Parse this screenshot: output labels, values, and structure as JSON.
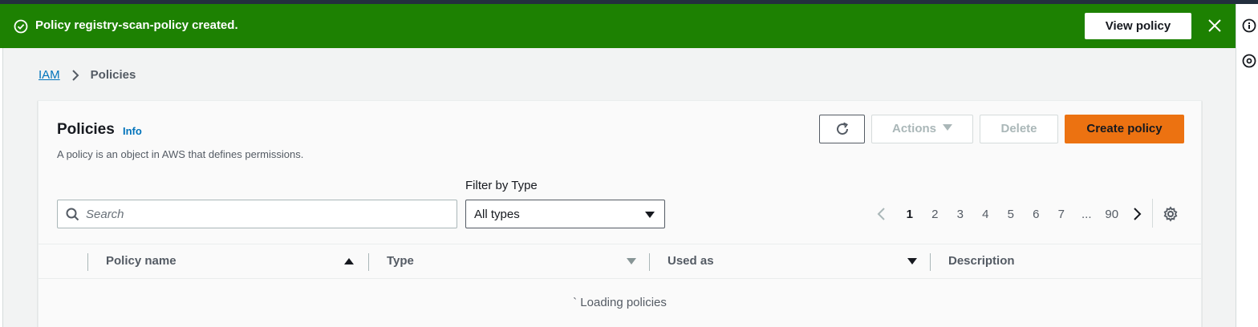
{
  "flash": {
    "message": "Policy registry-scan-policy created.",
    "button_label": "View policy",
    "icon": "check-circle-icon",
    "color": "#1d8102"
  },
  "breadcrumb": {
    "root": "IAM",
    "current": "Policies"
  },
  "panel": {
    "title": "Policies",
    "info": "Info",
    "description": "A policy is an object in AWS that defines permissions."
  },
  "toolbar": {
    "actions_label": "Actions",
    "delete_label": "Delete",
    "create_label": "Create policy",
    "create_color": "#ec7211"
  },
  "search": {
    "placeholder": "Search",
    "value": ""
  },
  "filter": {
    "label": "Filter by Type",
    "selected": "All types"
  },
  "pagination": {
    "pages": [
      "1",
      "2",
      "3",
      "4",
      "5",
      "6",
      "7"
    ],
    "current": "1",
    "ellipsis": "...",
    "last": "90"
  },
  "table": {
    "columns": [
      "Policy name",
      "Type",
      "Used as",
      "Description"
    ],
    "loading_text": "` Loading policies"
  }
}
